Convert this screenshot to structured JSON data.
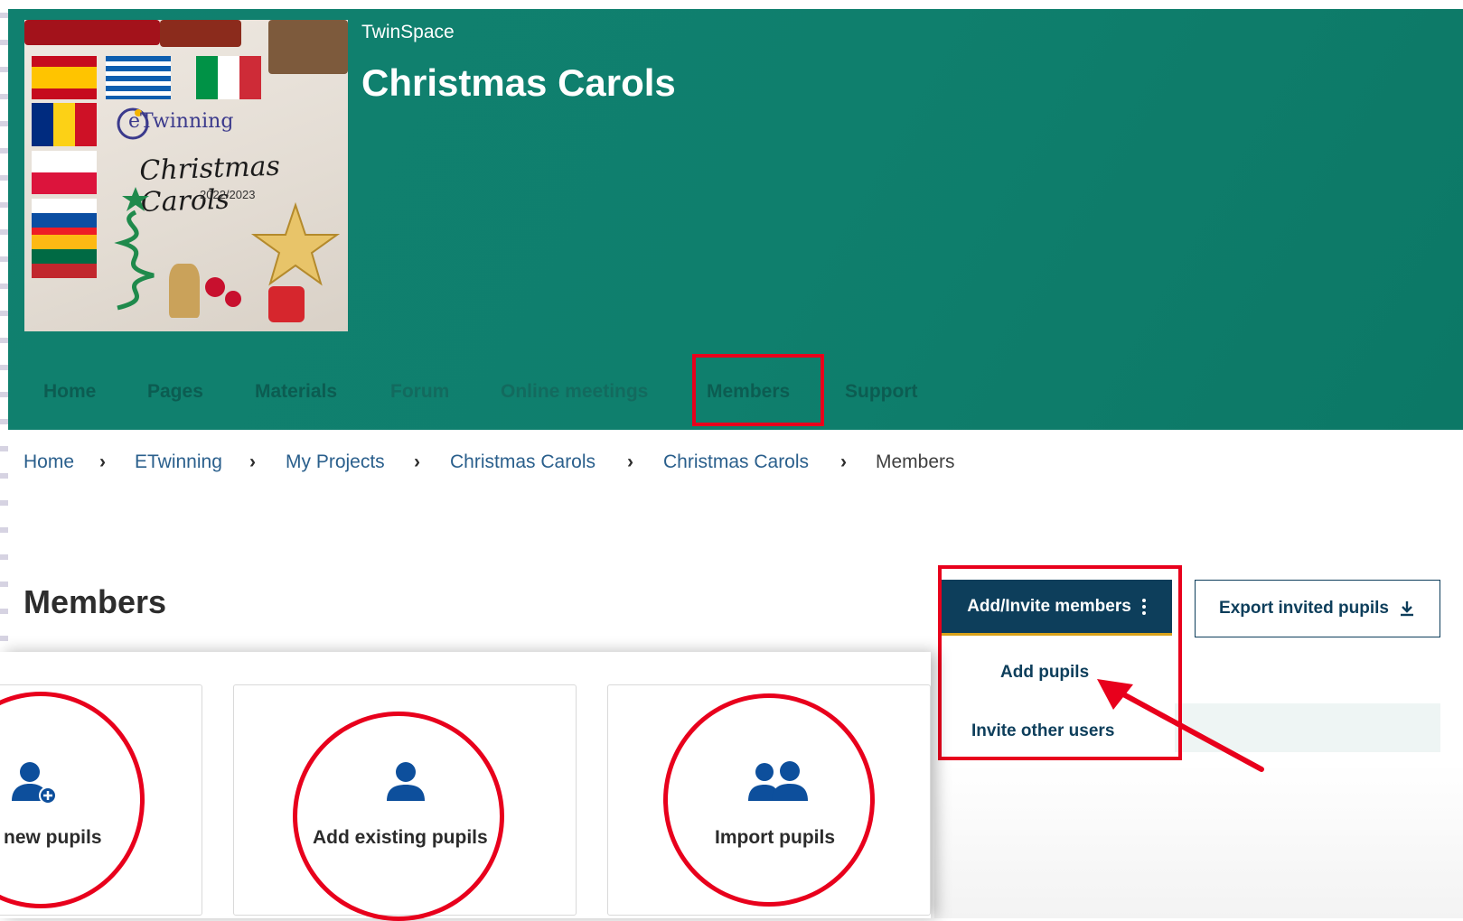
{
  "colors": {
    "header_bg": "#0f7f6d",
    "nav_text": "#0c5c51",
    "primary_button": "#0d3e5b",
    "accent_underline": "#d9a21b",
    "annotation_red": "#e8001c",
    "link_blue": "#2a5f8c",
    "icon_blue": "#0d4f9c"
  },
  "header": {
    "site_label": "TwinSpace",
    "project_title": "Christmas Carols",
    "project_image": {
      "brand_text": "eTwinning",
      "title_text": "Christmas Carols",
      "year_text": "2022/2023"
    }
  },
  "nav": {
    "items": [
      {
        "label": "Home"
      },
      {
        "label": "Pages"
      },
      {
        "label": "Materials"
      },
      {
        "label": "Forum"
      },
      {
        "label": "Online meetings"
      },
      {
        "label": "Members",
        "highlighted": true
      },
      {
        "label": "Support"
      }
    ]
  },
  "breadcrumb": {
    "items": [
      "Home",
      "ETwinning",
      "My Projects",
      "Christmas Carols",
      "Christmas Carols",
      "Members"
    ],
    "separator": "›"
  },
  "page": {
    "title": "Members"
  },
  "actions": {
    "add_invite_label": "Add/Invite members",
    "export_label": "Export invited pupils",
    "export_icon": "download-icon",
    "dropdown": [
      {
        "label": "Add pupils"
      },
      {
        "label": "Invite other users"
      }
    ]
  },
  "cards": [
    {
      "label": "new pupils",
      "icon": "add-user-icon"
    },
    {
      "label": "Add existing pupils",
      "icon": "user-icon"
    },
    {
      "label": "Import pupils",
      "icon": "users-icon"
    }
  ]
}
